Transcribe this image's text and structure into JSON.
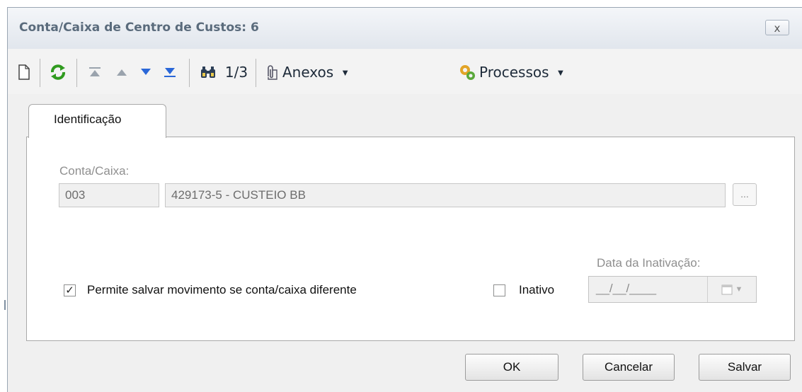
{
  "window": {
    "title": "Conta/Caixa de Centro de Custos: 6",
    "close_label": "x"
  },
  "toolbar": {
    "items": [
      "new-document",
      "refresh",
      "first-record",
      "previous-record",
      "next-record",
      "last-record",
      "search"
    ],
    "record_counter": "1/3",
    "anexos_label": "Anexos",
    "processos_label": "Processos"
  },
  "tabs": [
    {
      "label": "Identificação",
      "active": true
    }
  ],
  "form": {
    "conta_caixa_label": "Conta/Caixa:",
    "conta_caixa_code": "003",
    "conta_caixa_description": "429173-5 - CUSTEIO BB",
    "lookup_label": "...",
    "permite_salvar_label": "Permite salvar movimento se conta/caixa diferente",
    "permite_salvar_checked": true,
    "permite_salvar_mark": "✓",
    "inativo_label": "Inativo",
    "inativo_checked": false,
    "data_inativacao_label": "Data da Inativação:",
    "data_inativacao_value": "__/__/____"
  },
  "buttons": {
    "ok": "OK",
    "cancelar": "Cancelar",
    "salvar": "Salvar"
  },
  "colors": {
    "title_text": "#5a6b7c",
    "refresh_green": "#2f9a1e",
    "nav_blue": "#2a67d8",
    "nav_grey": "#9aa3ad"
  }
}
